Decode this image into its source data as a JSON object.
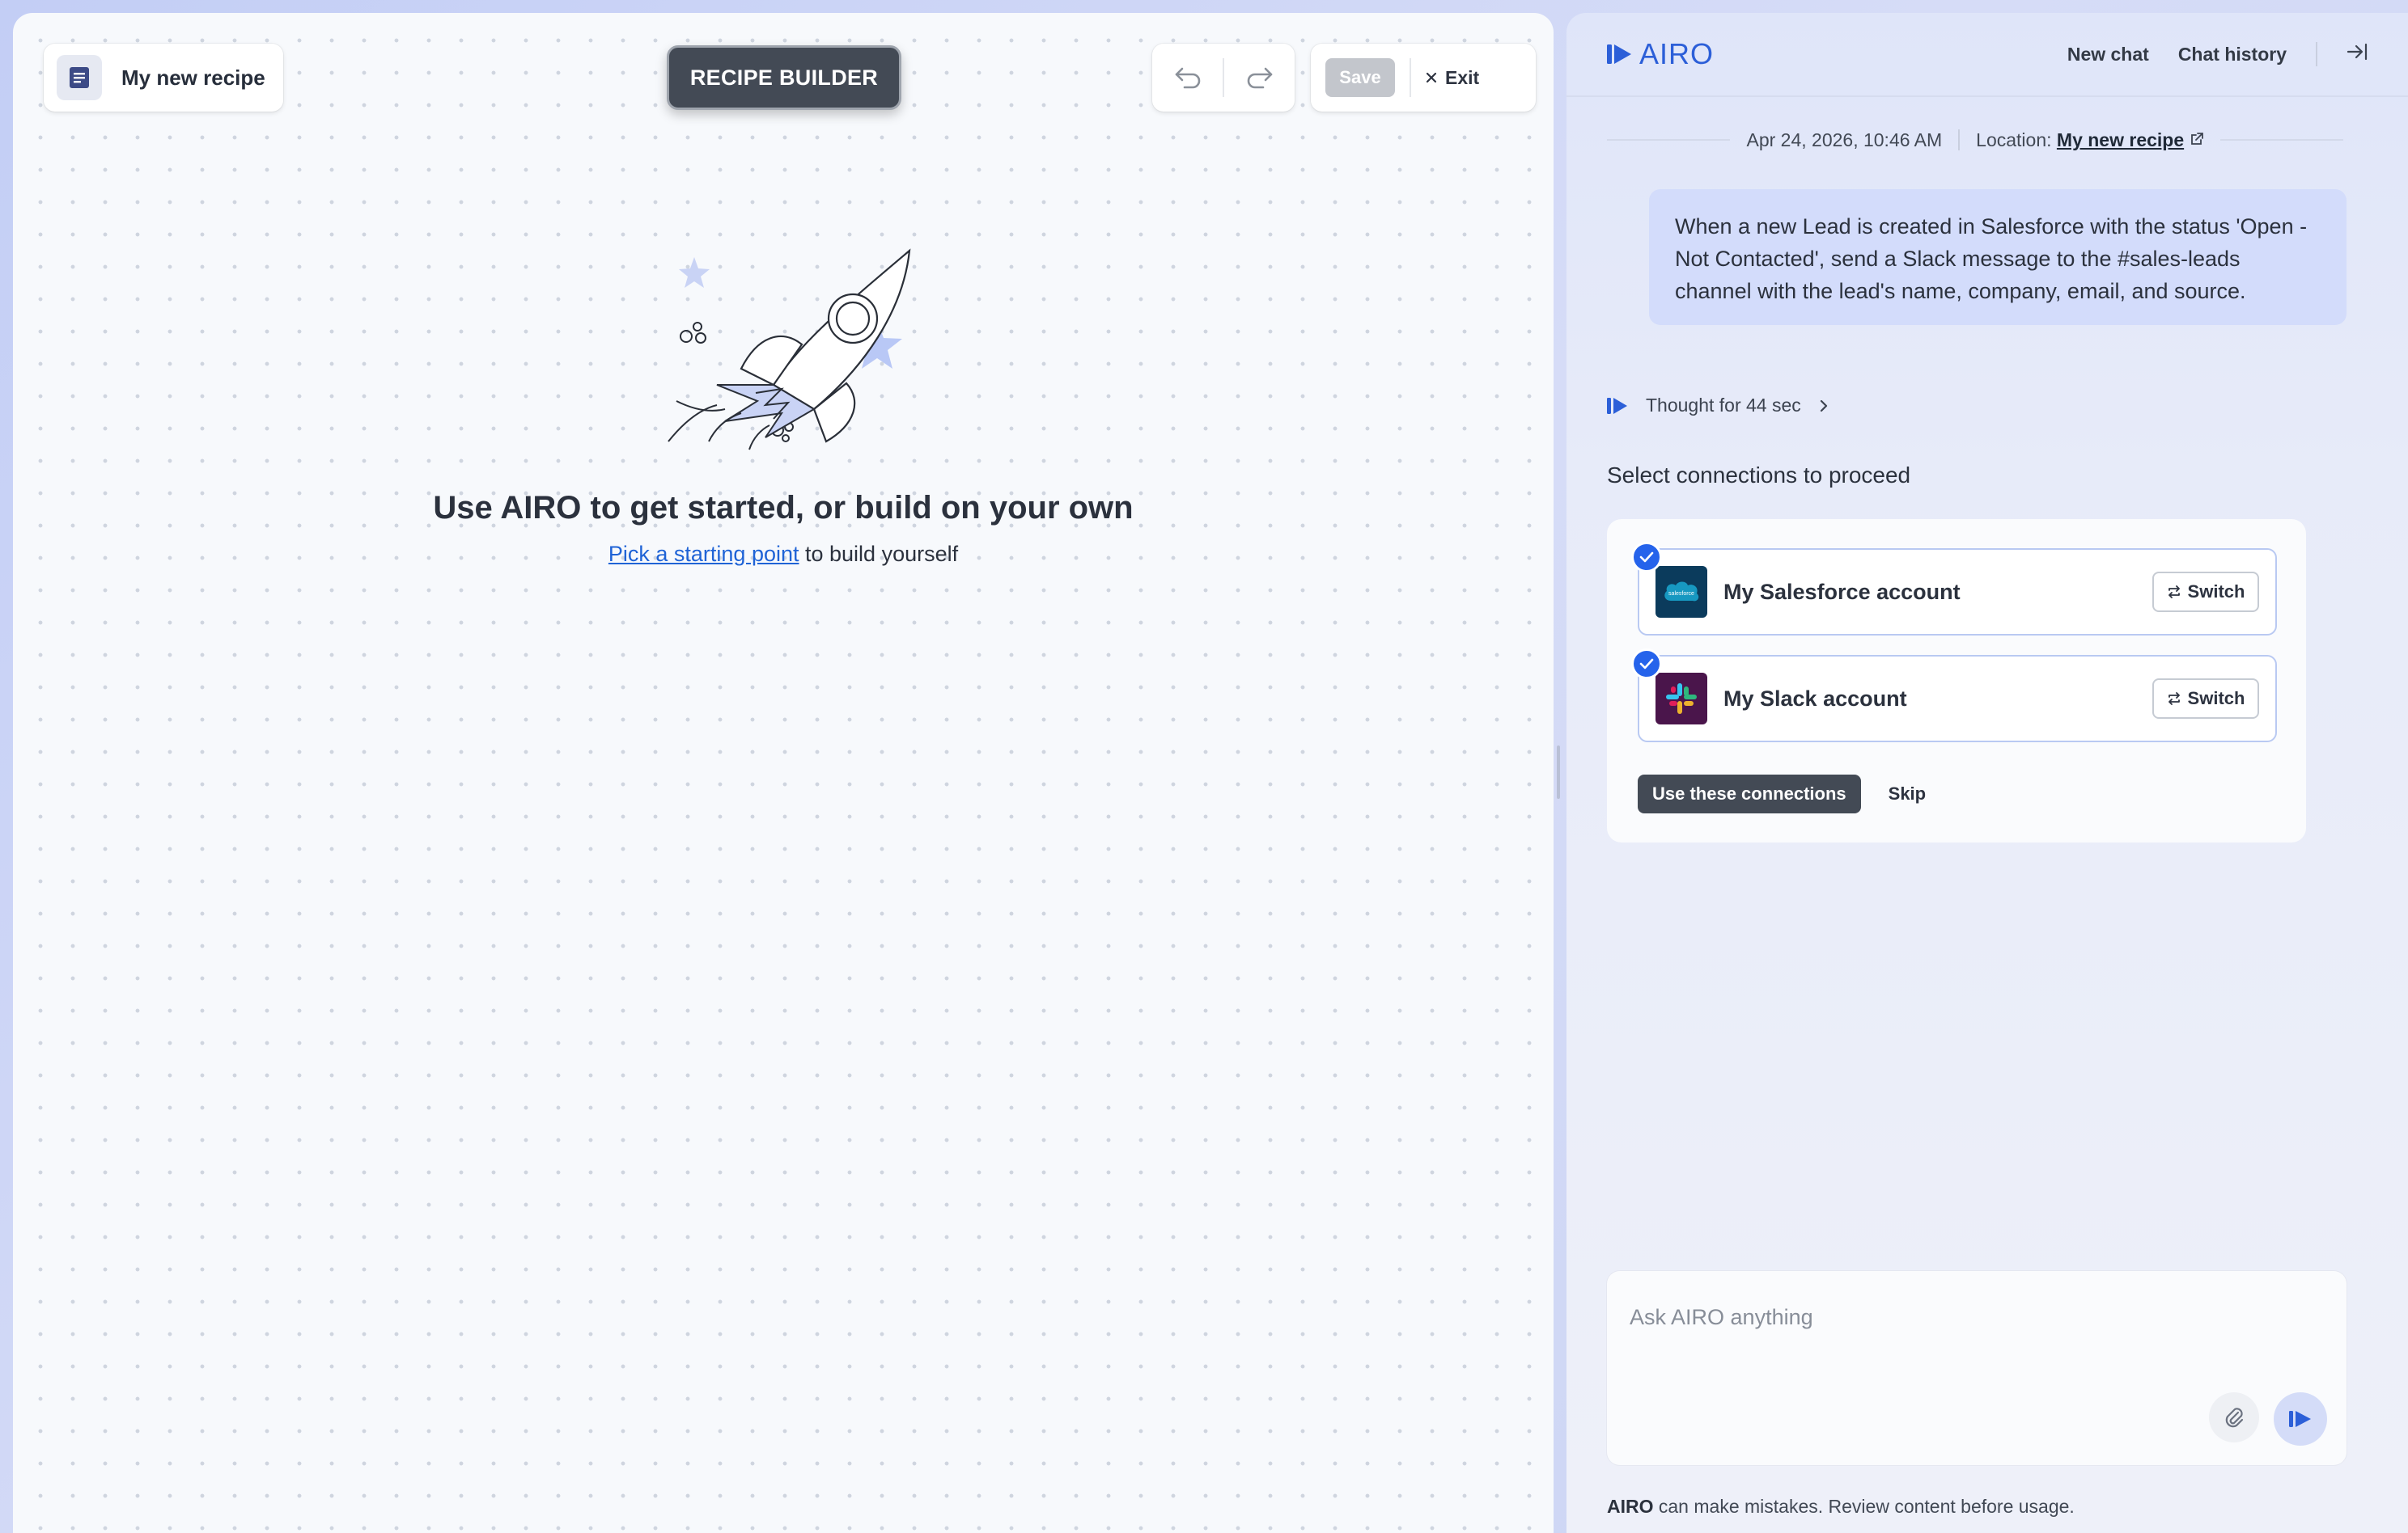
{
  "canvas": {
    "recipe_name": "My new recipe",
    "builder_label": "RECIPE BUILDER",
    "save_label": "Save",
    "exit_label": "Exit",
    "empty_title": "Use AIRO to get started, or build on your own",
    "empty_link": "Pick a starting point",
    "empty_suffix": " to build yourself"
  },
  "panel": {
    "brand": "AIRO",
    "new_chat": "New chat",
    "chat_history": "Chat history",
    "timestamp": "Apr 24, 2026, 10:46 AM",
    "location_prefix": "Location:",
    "location_link": "My new recipe",
    "user_message": "When a new Lead is created in Salesforce with the status 'Open - Not Contacted', send a Slack message to the #sales-leads channel with the lead's name, company, email, and source.",
    "thought": "Thought for 44 sec",
    "select_title": "Select connections to proceed",
    "connections": [
      {
        "label": "My Salesforce account",
        "switch": "Switch",
        "logo_text": "salesforce"
      },
      {
        "label": "My Slack account",
        "switch": "Switch"
      }
    ],
    "use_connections": "Use these connections",
    "skip": "Skip",
    "composer_placeholder": "Ask AIRO anything",
    "disclaimer_brand": "AIRO",
    "disclaimer_text": " can make mistakes. Review content before usage."
  },
  "colors": {
    "accent": "#2563eb",
    "brand": "#2c5fd8",
    "dark_button": "#434a55",
    "salesforce_bg": "#0b3b5c",
    "slack_bg": "#4a154b"
  }
}
